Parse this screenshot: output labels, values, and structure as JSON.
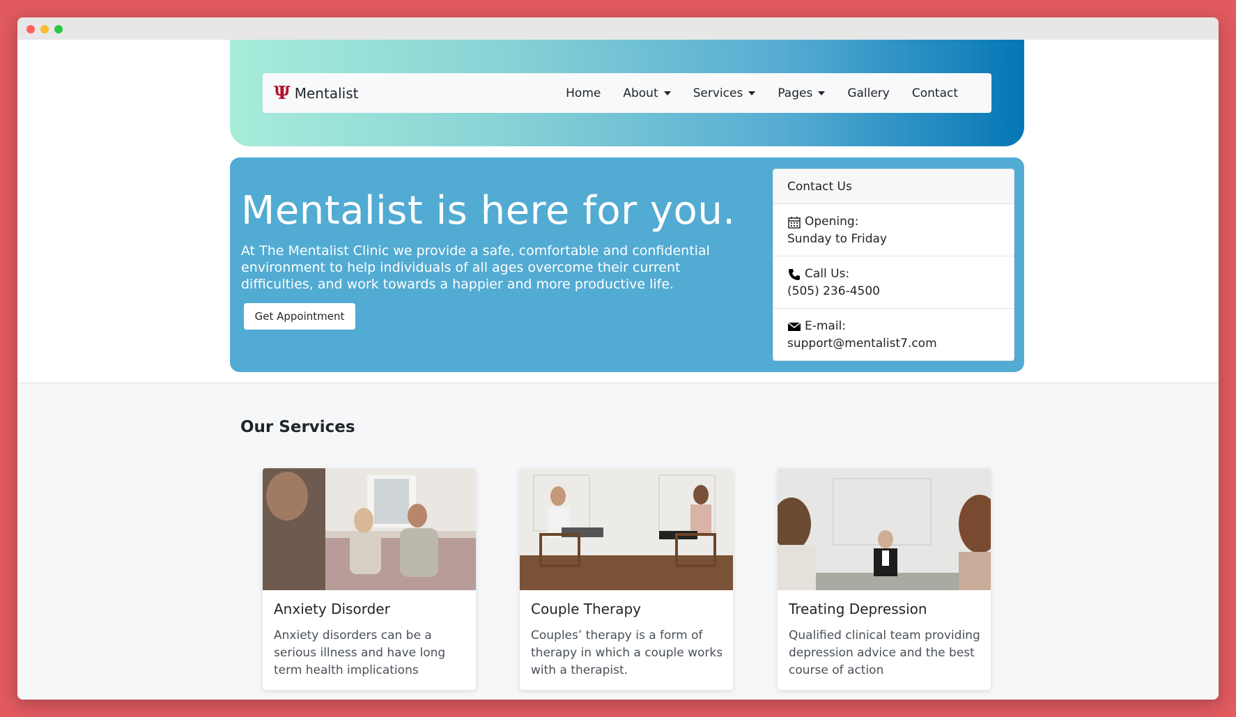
{
  "navbar": {
    "brand_icon": "psi-logo",
    "brand_logo_char": "Ψ",
    "brand_name": "Mentalist",
    "links": [
      "Home",
      "About",
      "Services",
      "Pages",
      "Gallery",
      "Contact"
    ]
  },
  "hero": {
    "title": "Mentalist is here for you.",
    "text": "At The Mentalist Clinic we provide a safe, comfortable and confidential environment to help individuals of all ages overcome their current difficulties, and work towards a happier and more productive life.",
    "button_label": "Get Appointment"
  },
  "contact": {
    "header": "Contact Us",
    "opening_label": "Opening:",
    "opening_value": "Sunday to Friday",
    "call_label": "Call Us:",
    "call_value": "(505) 236-4500",
    "email_label": "E-mail:",
    "email_value": "support@mentalist7.com"
  },
  "services": {
    "title": "Our Services",
    "cards": [
      {
        "title": "Anxiety Disorder",
        "text": "Anxiety disorders can be a serious illness and have long term health implications"
      },
      {
        "title": "Couple Therapy",
        "text": "Couples’ therapy is a form of therapy in which a couple works with a therapist."
      },
      {
        "title": "Treating Depression",
        "text": "Qualified clinical team providing depression advice and the best course of action"
      }
    ]
  },
  "colors": {
    "page_background": "#e05a5f",
    "hero_panel": "#52abd2",
    "brand_red": "#b3122b",
    "gradient_start": "#a8ecd9",
    "gradient_end": "#0577b5"
  }
}
